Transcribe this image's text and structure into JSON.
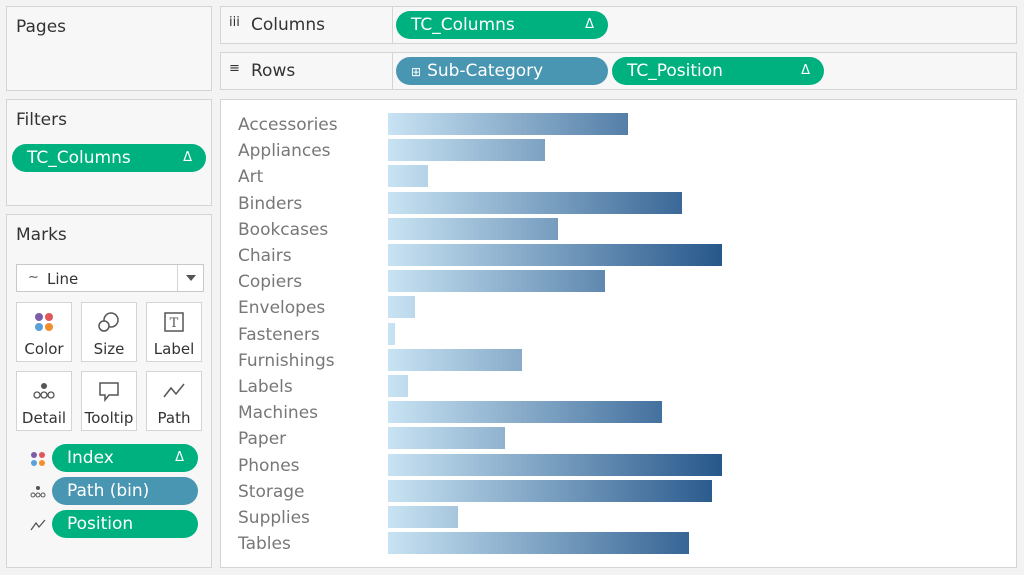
{
  "pages": {
    "title": "Pages"
  },
  "filters": {
    "title": "Filters",
    "pills": [
      {
        "label": "TC_Columns",
        "delta": "Δ"
      }
    ]
  },
  "marks": {
    "title": "Marks",
    "type": {
      "icon": "line-mark-icon",
      "label": "Line"
    },
    "buttons": [
      {
        "label": "Color",
        "icon": "color-dots-icon"
      },
      {
        "label": "Size",
        "icon": "size-icon"
      },
      {
        "label": "Label",
        "icon": "label-icon"
      },
      {
        "label": "Detail",
        "icon": "detail-icon"
      },
      {
        "label": "Tooltip",
        "icon": "tooltip-icon"
      },
      {
        "label": "Path",
        "icon": "path-icon"
      }
    ],
    "encodings": [
      {
        "icon": "color-dots-icon",
        "label": "Index",
        "delta": "Δ",
        "color": "#00b180"
      },
      {
        "icon": "detail-icon",
        "label": "Path (bin)",
        "delta": "",
        "color": "#4996b2"
      },
      {
        "icon": "path-icon",
        "label": "Position",
        "delta": "",
        "color": "#00b180"
      }
    ]
  },
  "columns_shelf": {
    "icon": "iii",
    "label": "Columns",
    "pills": [
      {
        "label": "TC_Columns",
        "delta": "Δ"
      }
    ]
  },
  "rows_shelf": {
    "icon": "≡",
    "label": "Rows",
    "pills": [
      {
        "label": "Sub-Category",
        "prefix": "⊞"
      },
      {
        "label": "TC_Position",
        "delta": "Δ"
      }
    ]
  },
  "colors": {
    "green_pill": "#00b180",
    "blue_pill": "#4996b2",
    "bar_start": "#c8e3f3",
    "bar_end": "#27578b"
  },
  "chart_data": {
    "type": "bar",
    "orientation": "horizontal",
    "categories": [
      "Accessories",
      "Appliances",
      "Art",
      "Binders",
      "Bookcases",
      "Chairs",
      "Copiers",
      "Envelopes",
      "Fasteners",
      "Furnishings",
      "Labels",
      "Machines",
      "Paper",
      "Phones",
      "Storage",
      "Supplies",
      "Tables"
    ],
    "values": [
      0.72,
      0.47,
      0.12,
      0.88,
      0.51,
      1.0,
      0.65,
      0.08,
      0.02,
      0.4,
      0.06,
      0.82,
      0.35,
      1.0,
      0.97,
      0.21,
      0.9
    ],
    "value_scale": "relative to longest bar"
  }
}
